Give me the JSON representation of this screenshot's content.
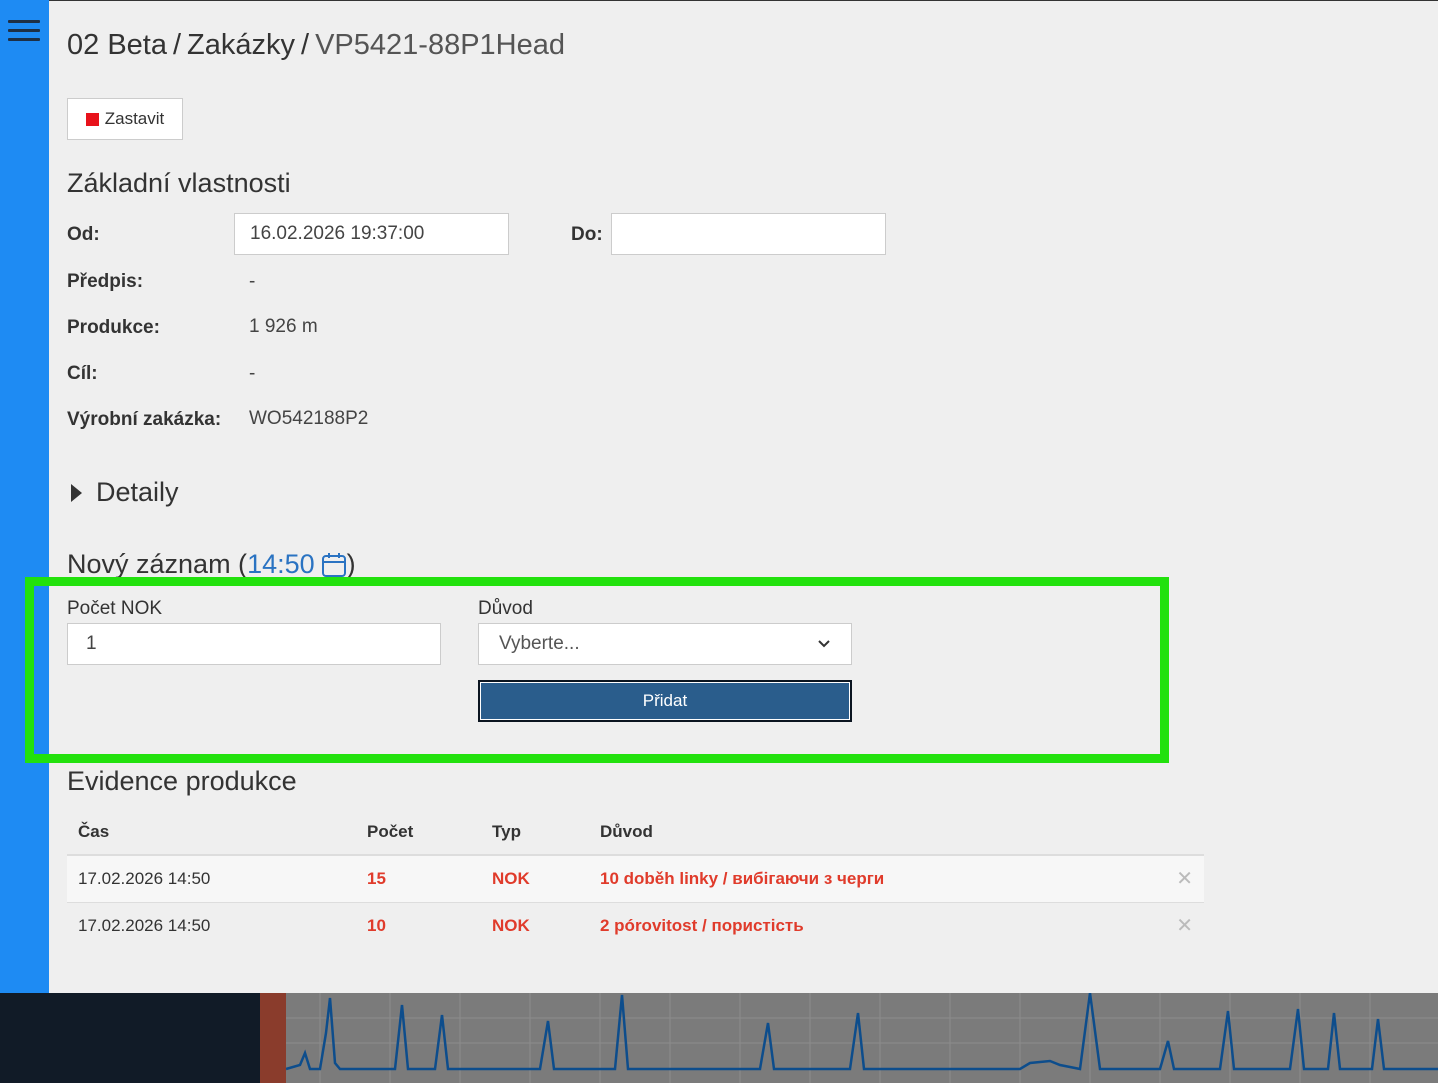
{
  "header": {
    "breadcrumb": [
      "02 Beta",
      "Zakázky",
      "VP5421-88P1Head"
    ],
    "separator": "/"
  },
  "toolbar": {
    "stop_label": "Zastavit"
  },
  "properties": {
    "title": "Základní vlastnosti",
    "from_label": "Od:",
    "from_value": "16.02.2026 19:37:00",
    "to_label": "Do:",
    "to_value": "",
    "spec_label": "Předpis:",
    "spec_value": "-",
    "production_label": "Produkce:",
    "production_value": "1 926 m",
    "target_label": "Cíl:",
    "target_value": "-",
    "work_order_label": "Výrobní zakázka:",
    "work_order_value": "WO542188P2"
  },
  "details": {
    "label": "Detaily"
  },
  "new_record": {
    "title_prefix": "Nový záznam (",
    "time": "14:50",
    "title_suffix": ")",
    "nok_label": "Počet NOK",
    "nok_value": "1",
    "reason_label": "Důvod",
    "reason_selected": "Vyberte...",
    "add_label": "Přidat"
  },
  "evidence": {
    "title": "Evidence produkce",
    "columns": [
      "Čas",
      "Počet",
      "Typ",
      "Důvod"
    ],
    "rows": [
      {
        "time": "17.02.2026 14:50",
        "count": "15",
        "type": "NOK",
        "reason": "10 doběh linky / вибігаючи з черги"
      },
      {
        "time": "17.02.2026 14:50",
        "count": "10",
        "type": "NOK",
        "reason": "2 pórovitost / пористість"
      }
    ]
  },
  "colors": {
    "sidebar": "#1e8bf3",
    "accent_link": "#2a73c2",
    "nok_red": "#e03b2b",
    "stop_red": "#e8121b",
    "highlight": "#22e10d",
    "add_button": "#2a5d8c"
  },
  "icons": {
    "menu": "hamburger-icon",
    "stop": "stop-square-icon",
    "calendar": "calendar-icon",
    "caret": "caret-right-icon",
    "select": "chevron-down-icon",
    "delete": "close-icon"
  }
}
